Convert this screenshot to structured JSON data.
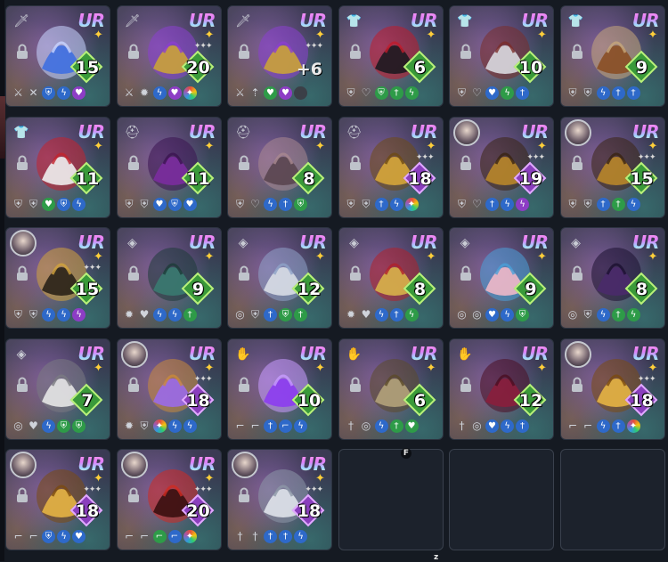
{
  "grid": {
    "rarity_label": "UR",
    "level_plus_prefix": "+",
    "cards": [
      {
        "slot": "weapon",
        "item": "blue-katana",
        "portrait": false,
        "level": "15",
        "level_style": "green",
        "pips": "",
        "stats": [
          "plain:swords",
          "plain:x",
          "blue:shield",
          "blue:bolt",
          "purple:heart"
        ]
      },
      {
        "slot": "weapon",
        "item": "golden-demon-blade",
        "portrait": false,
        "level": "20",
        "level_style": "green",
        "pips": "✦✦✦",
        "stats": [
          "plain:swords",
          "plain:burst",
          "blue:bolt",
          "purple:heart",
          "rainbow:spark"
        ]
      },
      {
        "slot": "weapon",
        "item": "golden-demon-blade",
        "portrait": false,
        "level": "6",
        "level_style": "plus",
        "pips": "✦✦✦",
        "stats": [
          "plain:swords",
          "plain:up",
          "green:heart",
          "purple:heart",
          "dark:empty"
        ]
      },
      {
        "slot": "armor",
        "item": "black-red-coat",
        "portrait": false,
        "level": "6",
        "level_style": "green",
        "pips": "",
        "stats": [
          "plain:shield",
          "plain:heart-up",
          "green:shield",
          "green:sword",
          "green:bolt"
        ]
      },
      {
        "slot": "armor",
        "item": "white-jacket",
        "portrait": false,
        "level": "10",
        "level_style": "green",
        "pips": "",
        "stats": [
          "plain:shield",
          "plain:heart-up",
          "blue:heart",
          "green:bolt",
          "blue:sword"
        ]
      },
      {
        "slot": "armor",
        "item": "leather-armor",
        "portrait": false,
        "level": "9",
        "level_style": "green",
        "pips": "",
        "stats": [
          "plain:shield",
          "plain:shield",
          "blue:bolt",
          "blue:sword",
          "blue:sword"
        ]
      },
      {
        "slot": "armor",
        "item": "white-red-outfit",
        "portrait": false,
        "level": "11",
        "level_style": "green",
        "pips": "",
        "stats": [
          "plain:shield",
          "plain:shield",
          "green:heart",
          "blue:shield",
          "blue:bolt"
        ]
      },
      {
        "slot": "helmet",
        "item": "purple-ribbon",
        "portrait": false,
        "level": "11",
        "level_style": "green",
        "pips": "",
        "stats": [
          "plain:shield",
          "plain:shield",
          "blue:heart",
          "blue:shield",
          "blue:heart"
        ]
      },
      {
        "slot": "helmet",
        "item": "round-glasses",
        "portrait": false,
        "level": "8",
        "level_style": "green",
        "pips": "",
        "stats": [
          "plain:shield",
          "plain:heart-up",
          "blue:bolt",
          "blue:sword",
          "green:shield"
        ]
      },
      {
        "slot": "helmet",
        "item": "golden-crown",
        "portrait": false,
        "level": "18",
        "level_style": "purple",
        "pips": "✦✦✦",
        "stats": [
          "plain:shield",
          "plain:shield",
          "blue:sword",
          "blue:bolt",
          "rainbow:spark"
        ]
      },
      {
        "slot": "helmet",
        "item": "golden-horned-helm",
        "portrait": true,
        "level": "19",
        "level_style": "purple",
        "pips": "✦✦✦",
        "stats": [
          "plain:shield",
          "plain:heart-up",
          "blue:sword",
          "blue:bolt",
          "purple:bolt"
        ]
      },
      {
        "slot": "helmet",
        "item": "golden-horned-helm",
        "portrait": true,
        "level": "15",
        "level_style": "green",
        "pips": "✦✦✦",
        "stats": [
          "plain:shield",
          "plain:shield",
          "blue:sword",
          "green:sword",
          "blue:bolt"
        ]
      },
      {
        "slot": "helmet",
        "item": "dark-gold-helm",
        "portrait": true,
        "level": "15",
        "level_style": "green",
        "pips": "✦✦✦",
        "stats": [
          "plain:shield",
          "plain:shield",
          "blue:bolt",
          "blue:bolt",
          "purple:bolt"
        ]
      },
      {
        "slot": "accessory",
        "item": "teal-wings",
        "portrait": false,
        "level": "9",
        "level_style": "green",
        "pips": "",
        "stats": [
          "plain:burst",
          "plain:heart",
          "blue:bolt",
          "blue:bolt",
          "green:sword"
        ]
      },
      {
        "slot": "accessory",
        "item": "silver-ring",
        "portrait": false,
        "level": "12",
        "level_style": "green",
        "pips": "",
        "stats": [
          "plain:target",
          "plain:shield",
          "blue:sword",
          "green:shield",
          "green:sword"
        ]
      },
      {
        "slot": "accessory",
        "item": "red-gold-mask",
        "portrait": false,
        "level": "8",
        "level_style": "green",
        "pips": "",
        "stats": [
          "plain:burst",
          "plain:heart",
          "blue:bolt",
          "blue:sword",
          "green:bolt"
        ]
      },
      {
        "slot": "accessory",
        "item": "anime-doll",
        "portrait": false,
        "level": "9",
        "level_style": "green",
        "pips": "",
        "stats": [
          "plain:target",
          "plain:target",
          "blue:heart",
          "blue:bolt",
          "green:shield"
        ]
      },
      {
        "slot": "accessory",
        "item": "bat-familiar",
        "portrait": false,
        "level": "8",
        "level_style": "green",
        "pips": "",
        "stats": [
          "plain:target",
          "plain:shield",
          "blue:bolt",
          "green:sword",
          "green:bolt"
        ]
      },
      {
        "slot": "accessory",
        "item": "winged-skull",
        "portrait": false,
        "level": "7",
        "level_style": "green",
        "pips": "",
        "stats": [
          "plain:target",
          "plain:heart",
          "blue:bolt",
          "green:shield",
          "green:shield"
        ]
      },
      {
        "slot": "accessory",
        "item": "purple-lantern-ring",
        "portrait": true,
        "level": "18",
        "level_style": "purple",
        "pips": "✦✦✦",
        "stats": [
          "plain:burst",
          "plain:shield",
          "rainbow:spark",
          "blue:bolt",
          "blue:bolt"
        ]
      },
      {
        "slot": "gloves",
        "item": "violet-chain",
        "portrait": false,
        "level": "10",
        "level_style": "green",
        "pips": "",
        "stats": [
          "plain:boot",
          "plain:boot",
          "blue:sword",
          "blue:boot",
          "blue:bolt"
        ]
      },
      {
        "slot": "gloves",
        "item": "golden-gauntlet",
        "portrait": false,
        "level": "6",
        "level_style": "green",
        "pips": "",
        "stats": [
          "plain:sword",
          "plain:target",
          "blue:bolt",
          "green:sword",
          "green:heart"
        ]
      },
      {
        "slot": "gloves",
        "item": "crimson-gloves",
        "portrait": false,
        "level": "12",
        "level_style": "green",
        "pips": "",
        "stats": [
          "plain:sword",
          "plain:target",
          "blue:heart",
          "blue:bolt",
          "blue:sword"
        ]
      },
      {
        "slot": "gloves",
        "item": "gold-bracer",
        "portrait": true,
        "level": "18",
        "level_style": "purple",
        "pips": "✦✦✦",
        "stats": [
          "plain:boot",
          "plain:boot",
          "blue:bolt",
          "blue:sword",
          "rainbow:spark"
        ]
      },
      {
        "slot": "gloves",
        "item": "gold-bracer",
        "portrait": true,
        "level": "18",
        "level_style": "purple",
        "pips": "✦✦✦",
        "stats": [
          "plain:boot",
          "plain:boot",
          "blue:shield",
          "blue:bolt",
          "blue:heart"
        ]
      },
      {
        "slot": "gloves",
        "item": "dark-red-bracer",
        "portrait": true,
        "level": "20",
        "level_style": "purple",
        "pips": "✦✦✦",
        "stats": [
          "plain:boot",
          "plain:boot",
          "green:boot",
          "blue:boot",
          "rainbow:spark"
        ]
      },
      {
        "slot": "gloves",
        "item": "silver-gauntlets",
        "portrait": true,
        "level": "18",
        "level_style": "purple",
        "pips": "✦✦✦",
        "stats": [
          "plain:sword",
          "plain:sword",
          "blue:sword",
          "blue:sword",
          "blue:bolt"
        ]
      }
    ],
    "empty_slots": 3
  },
  "markers": {
    "f": "F",
    "z": "z"
  },
  "colors": {
    "background": "#151a22",
    "level_green": "#3a9a3a",
    "level_purple": "#8a3fbd",
    "star": "#ffcf3a"
  }
}
